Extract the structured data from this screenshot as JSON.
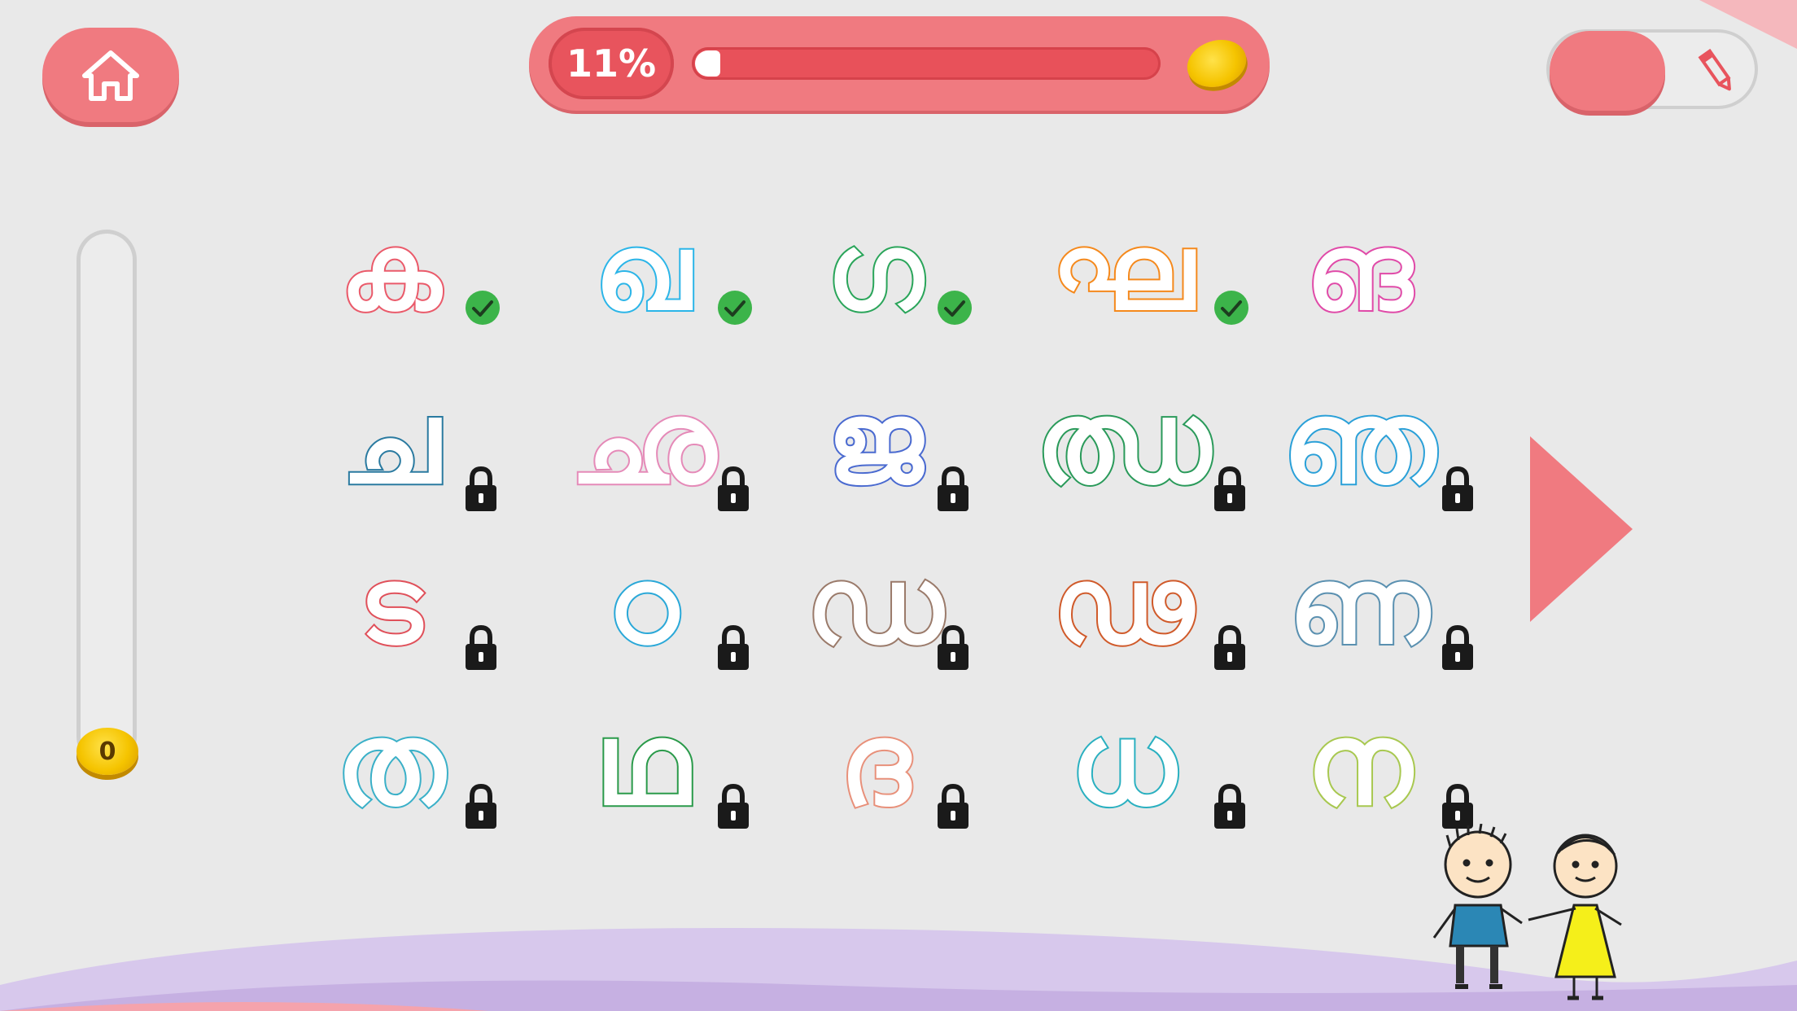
{
  "header": {
    "home_icon": "house-icon",
    "progress_label": "11%",
    "progress_fraction": 0.11,
    "coin_icon": "gold-coin-icon",
    "mode_toggle_icon": "pencil-icon"
  },
  "meter": {
    "coin_count": "0"
  },
  "letters": [
    {
      "char": "ക",
      "color": "#ea5a6a",
      "state": "done"
    },
    {
      "char": "ഖ",
      "color": "#2bb5e8",
      "state": "done"
    },
    {
      "char": "ഗ",
      "color": "#2aa55a",
      "state": "done"
    },
    {
      "char": "ഘ",
      "color": "#f5891c",
      "state": "done"
    },
    {
      "char": "ങ",
      "color": "#e04aa8",
      "state": "open"
    },
    {
      "char": "ച",
      "color": "#2a7aa0",
      "state": "locked"
    },
    {
      "char": "ഛ",
      "color": "#e58ab8",
      "state": "locked"
    },
    {
      "char": "ജ",
      "color": "#4a6ad0",
      "state": "locked"
    },
    {
      "char": "ഝ",
      "color": "#2a9a5a",
      "state": "locked"
    },
    {
      "char": "ഞ",
      "color": "#2aa0d8",
      "state": "locked"
    },
    {
      "char": "ട",
      "color": "#e0505a",
      "state": "locked"
    },
    {
      "char": "ഠ",
      "color": "#2aa8d8",
      "state": "locked"
    },
    {
      "char": "ഡ",
      "color": "#9a7a6a",
      "state": "locked"
    },
    {
      "char": "ഢ",
      "color": "#d05a2a",
      "state": "locked"
    },
    {
      "char": "ണ",
      "color": "#5a90b0",
      "state": "locked"
    },
    {
      "char": "ത",
      "color": "#3ab0c8",
      "state": "locked"
    },
    {
      "char": "ഥ",
      "color": "#2a9a4a",
      "state": "locked"
    },
    {
      "char": "ദ",
      "color": "#e8907a",
      "state": "locked"
    },
    {
      "char": "ധ",
      "color": "#2ab0c0",
      "state": "locked"
    },
    {
      "char": "ന",
      "color": "#a8c850",
      "state": "locked"
    }
  ],
  "icons": {
    "check": "check-circle-icon",
    "lock": "padlock-icon",
    "next": "next-arrow-icon"
  }
}
